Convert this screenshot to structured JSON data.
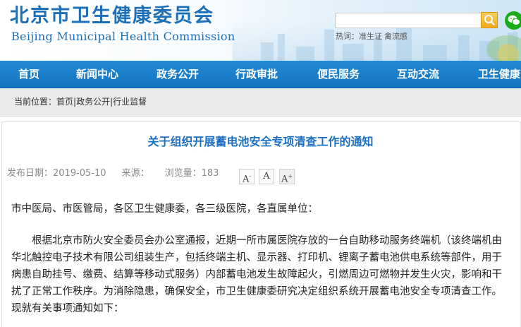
{
  "header": {
    "title": "北京市卫生健康委员会",
    "subtitle": "Beijing Municipal Health Commission",
    "search": {
      "placeholder": ""
    },
    "hot_label": "热词：",
    "hot_words": [
      "准生证",
      "禽流感"
    ]
  },
  "nav": {
    "items": [
      {
        "label": "首页"
      },
      {
        "label": "新闻中心"
      },
      {
        "label": "政务公开"
      },
      {
        "label": "行政审批"
      },
      {
        "label": "便民服务"
      },
      {
        "label": "互动交流"
      },
      {
        "label": "卫生健康"
      }
    ]
  },
  "breadcrumb": {
    "prefix": "当前位置：",
    "items": [
      "首页",
      "政务公开",
      "行业监督"
    ],
    "separator": "|"
  },
  "article": {
    "title": "关于组织开展蓄电池安全专项清查工作的通知",
    "publish_label": "发布日期：2019-05-10",
    "source_label": "来源：",
    "views_label": "浏览量：183",
    "font_controls": [
      "A-",
      "A",
      "A+"
    ],
    "greeting": "市中医局、市医管局，各区卫生健康委，各三级医院，各直属单位：",
    "paragraph": "根据北京市防火安全委员会办公室通报，近期一所市属医院存放的一台自助移动服务终端机（该终端机由华北触控电子技术有限公司组装生产，包括终端主机、显示器、打印机、锂离子蓄电池供电系统等部件，用于病患自助挂号、缴费、结算等移动式服务）内部蓄电池发生故障起火，引燃周边可燃物并发生火灾，影响和干扰了正常工作秩序。为消除隐患，确保安全，市卫生健康委研究决定组织系统开展蓄电池安全专项清查工作。现就有关事项通知如下："
  },
  "colors": {
    "brand_blue": "#1d70b8",
    "nav_blue": "#1a7fcf",
    "title_blue": "#1a6fc4",
    "search_orange": "#f0a81a",
    "wechat_green": "#1aad19"
  },
  "icons": {
    "search": "search-icon",
    "wechat": "wechat-icon"
  }
}
